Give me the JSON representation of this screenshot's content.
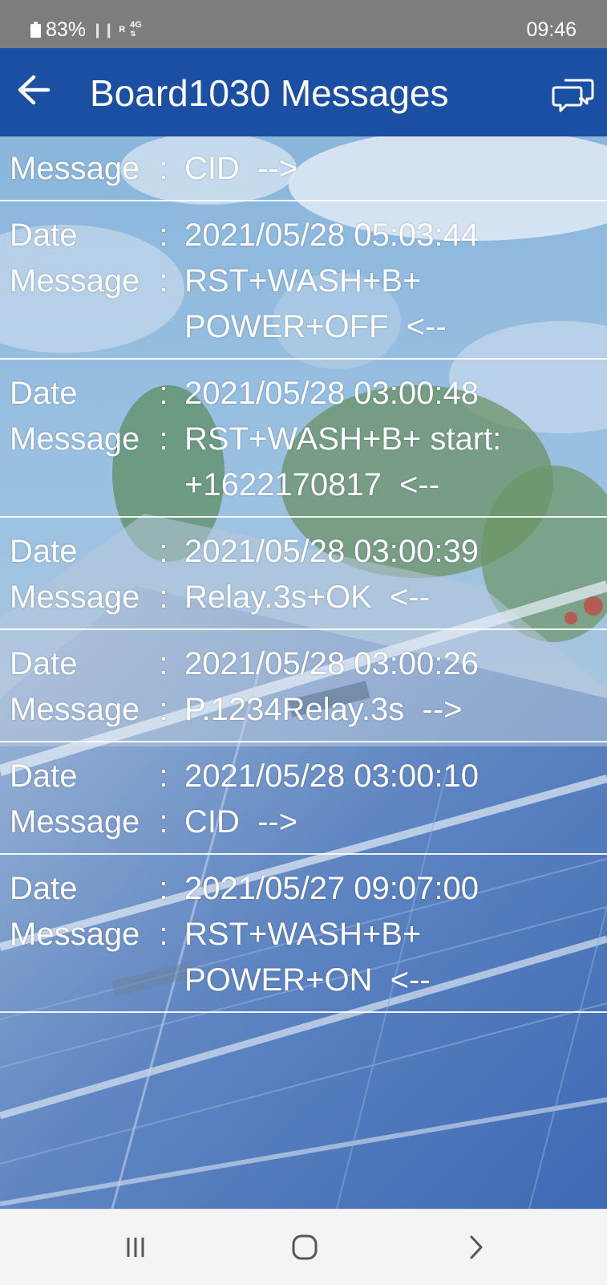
{
  "status_bar": {
    "battery": "83%",
    "network_type": "4G",
    "signal_tag": "R",
    "time": "09:46"
  },
  "app_bar": {
    "title": "Board1030 Messages",
    "back_icon": "arrow-left-icon",
    "action_icon": "chat-bubbles-icon"
  },
  "colors": {
    "status_bar_bg": "#7d7d7d",
    "app_bar_bg": "#1a4fa3",
    "text": "#ffffff",
    "nav_bar_bg": "#f4f4f4"
  },
  "labels": {
    "date": "Date",
    "message": "Message",
    "separator": ":"
  },
  "messages": [
    {
      "date": "",
      "message": "CID  -->"
    },
    {
      "date": "2021/05/28 05:03:44",
      "message": "RST+WASH+B+\nPOWER+OFF  <--"
    },
    {
      "date": "2021/05/28 03:00:48",
      "message": "RST+WASH+B+ start:\n+1622170817  <--"
    },
    {
      "date": "2021/05/28 03:00:39",
      "message": "Relay.3s+OK  <--"
    },
    {
      "date": "2021/05/28 03:00:26",
      "message": "P.1234Relay.3s  -->"
    },
    {
      "date": "2021/05/28 03:00:10",
      "message": "CID  -->"
    },
    {
      "date": "2021/05/27 09:07:00",
      "message": "RST+WASH+B+\nPOWER+ON  <--"
    }
  ],
  "nav_bar": {
    "recent_icon": "recent-apps-icon",
    "home_icon": "home-icon",
    "back_icon": "back-chevron-icon"
  }
}
